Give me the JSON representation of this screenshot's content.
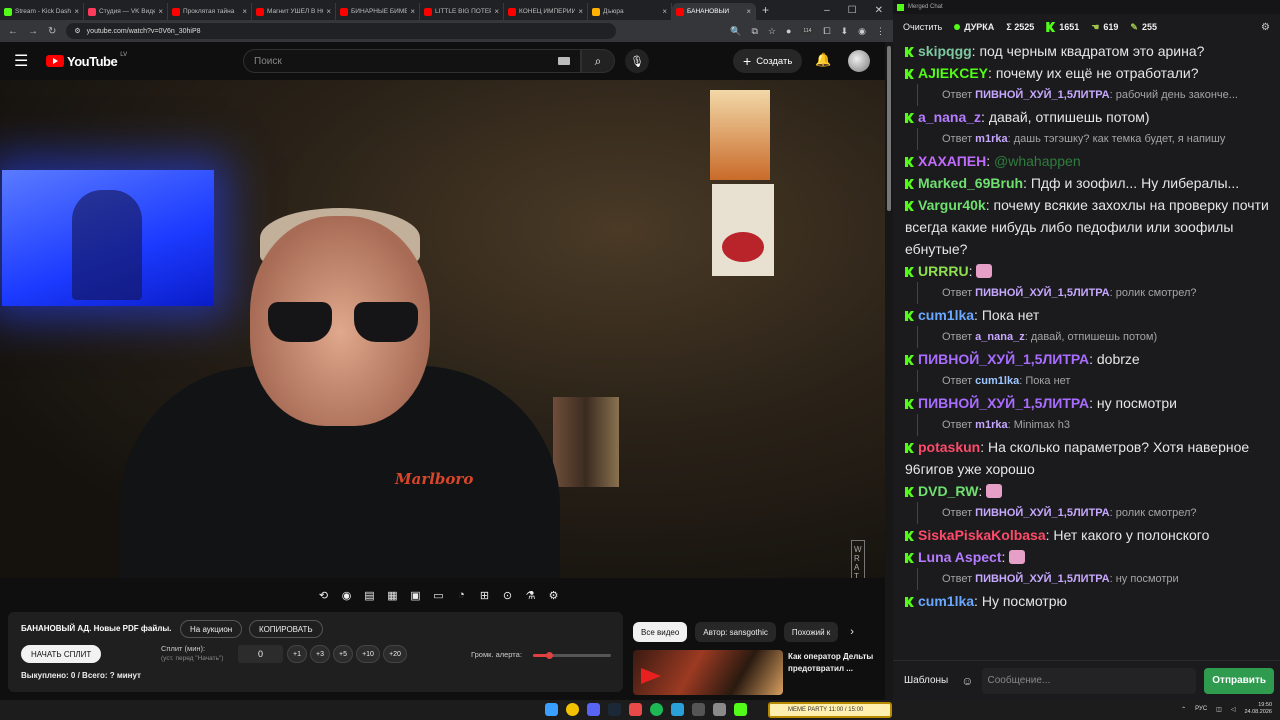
{
  "browser": {
    "tabs": [
      {
        "title": "Stream - Kick Dash",
        "color": "#53fc18"
      },
      {
        "title": "Студия — VK Видео",
        "color": "#ff3b5c"
      },
      {
        "title": "Проклятая тайна",
        "color": "#ff0000"
      },
      {
        "title": "Магнит УШЁЛ В НО",
        "color": "#ff0000"
      },
      {
        "title": "БИНАРНЫЕ БИМБ",
        "color": "#ff0000"
      },
      {
        "title": "LITTLE BIG ПОТЕР",
        "color": "#ff0000"
      },
      {
        "title": "КОНЕЦ ИМПЕРИИ",
        "color": "#ff0000"
      },
      {
        "title": "Дъюра",
        "color": "#ffb000"
      },
      {
        "title": "БАНАНОВЫЙ",
        "color": "#ff0000",
        "active": true
      }
    ],
    "url": "youtube.com/watch?v=0V6n_30hiP8",
    "ext_badge": "114"
  },
  "youtube": {
    "logo_text": "YouTube",
    "region": "LV",
    "search_placeholder": "Поиск",
    "create_label": "Создать"
  },
  "video": {
    "shirt_logo": "Marlboro",
    "watermark": "WRATH"
  },
  "auction": {
    "title": "БАНАНОВЫЙ АД. Новые PDF файлы.",
    "auction_button": "На аукцион",
    "copy_button": "КОПИРОВАТЬ",
    "start_button": "НАЧАТЬ СПЛИТ",
    "split_label": "Сплит (мин):",
    "split_hint": "(уст. перед \"Начать\")",
    "split_value": "0",
    "increments": [
      "+1",
      "+3",
      "+5",
      "+10",
      "+20"
    ],
    "volume_label": "Громк. алерта:",
    "volume_level": 0.2,
    "sold_text": "Выкуплено: 0 / Всего: ? минут"
  },
  "recommended": {
    "chips": [
      "Все видео",
      "Автор: sansgothic",
      "Похожий к"
    ],
    "video_title": "Как оператор Дельты предотвратил ..."
  },
  "chat": {
    "window_title": "Merged Chat",
    "clear_label": "Очистить",
    "stats": [
      {
        "label": "ДУРКА",
        "icon": "live-dot-icon"
      },
      {
        "label": "Σ 2525",
        "icon": "sum-icon"
      },
      {
        "label": "1651",
        "icon": "kick-icon"
      },
      {
        "label": "619",
        "icon": "twitch-icon"
      },
      {
        "label": "255",
        "icon": "vk-icon"
      }
    ],
    "messages": [
      {
        "type": "msg",
        "user": "skipqgg",
        "color": "#7ec8a0",
        "text": "под черным квадратом это арина?"
      },
      {
        "type": "msg",
        "user": "AJIEKCEY",
        "color": "#53fc18",
        "text": "почему их ещё не отработали?"
      },
      {
        "type": "reply",
        "prefix": "Ответ",
        "user": "ПИВНОЙ_ХУЙ_1,5ЛИТРА",
        "text": "рабочий день законче..."
      },
      {
        "type": "msg",
        "user": "a_nana_z",
        "color": "#b57cff",
        "text": "давай, отпишешь потом)"
      },
      {
        "type": "reply",
        "prefix": "Ответ",
        "user": "m1rka",
        "text": "дашь тэгэшку? как темка будет, я напишу"
      },
      {
        "type": "msg",
        "user": "ХАХАПЕН",
        "color": "#c26bff",
        "text": "@whahappen",
        "mention": true
      },
      {
        "type": "msg",
        "user": "Marked_69Bruh",
        "color": "#6fe06f",
        "text": "Пдф и зоофил... Ну либералы..."
      },
      {
        "type": "msg",
        "user": "Vargur40k",
        "color": "#6fe06f",
        "text": "почему всякие захохлы на проверку почти всегда какие нибудь либо педофили или зоофилы ебнутые?"
      },
      {
        "type": "msg",
        "user": "URRRU",
        "color": "#8ee04f",
        "text": ""
      },
      {
        "type": "reply",
        "prefix": "Ответ",
        "user": "ПИВНОЙ_ХУЙ_1,5ЛИТРА",
        "text": "ролик смотрел?"
      },
      {
        "type": "msg",
        "user": "cum1lka",
        "color": "#6aa8ff",
        "text": "Пока нет"
      },
      {
        "type": "reply",
        "prefix": "Ответ",
        "user": "a_nana_z",
        "text": "давай, отпишешь потом)"
      },
      {
        "type": "msg",
        "user": "ПИВНОЙ_ХУЙ_1,5ЛИТРА",
        "color": "#a86cff",
        "text": "dobrze"
      },
      {
        "type": "reply",
        "prefix": "Ответ",
        "user": "cum1lka",
        "text": "Пока нет",
        "blue": true
      },
      {
        "type": "msg",
        "user": "ПИВНОЙ_ХУЙ_1,5ЛИТРА",
        "color": "#a86cff",
        "text": "ну посмотри"
      },
      {
        "type": "reply",
        "prefix": "Ответ",
        "user": "m1rka",
        "text": "Minimax h3"
      },
      {
        "type": "msg",
        "user": "potaskun",
        "color": "#ff4a6a",
        "text": "На сколько параметров? Хотя наверное 96гигов уже хорошо"
      },
      {
        "type": "msg",
        "user": "DVD_RW",
        "color": "#6fe06f",
        "text": ""
      },
      {
        "type": "reply",
        "prefix": "Ответ",
        "user": "ПИВНОЙ_ХУЙ_1,5ЛИТРА",
        "text": "ролик смотрел?"
      },
      {
        "type": "msg",
        "user": "SiskaPiskaKolbasa",
        "color": "#ff4a6a",
        "text": "Нет какого у полонского"
      },
      {
        "type": "msg",
        "user": "Luna Aspect",
        "color": "#b57cff",
        "text": ""
      },
      {
        "type": "reply",
        "prefix": "Ответ",
        "user": "ПИВНОЙ_ХУЙ_1,5ЛИТРА",
        "text": "ну посмотри"
      },
      {
        "type": "msg",
        "user": "cum1lka",
        "color": "#6aa8ff",
        "text": "Ну посмотрю"
      }
    ],
    "templates_label": "Шаблоны",
    "input_placeholder": "Сообщение...",
    "send_label": "Отправить"
  },
  "taskbar": {
    "kick_bar": "MEME PARTY 11:00 / 15:00",
    "lang": "РУС",
    "time": "19:50",
    "date": "24.08.2026"
  }
}
